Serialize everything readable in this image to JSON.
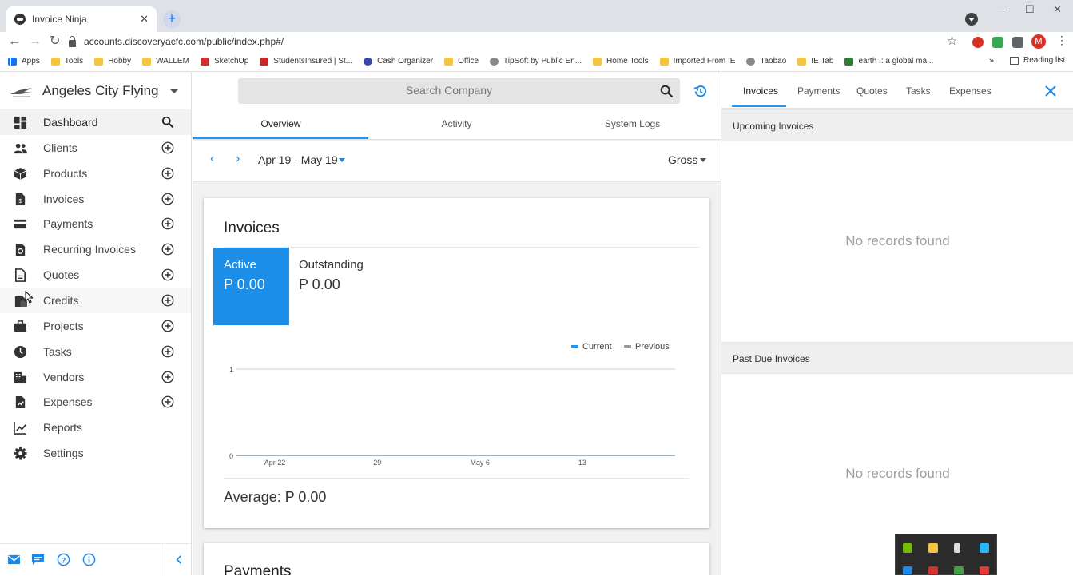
{
  "browser": {
    "tab_title": "Invoice Ninja",
    "new_tab": "+",
    "url": "accounts.discoveryacfc.com/public/index.php#/",
    "profile_initial": "M",
    "bookmarks": [
      "Apps",
      "Tools",
      "Hobby",
      "WALLEM",
      "SketchUp",
      "StudentsInsured | St...",
      "Cash Organizer",
      "Office",
      "TipSoft by Public En...",
      "Home Tools",
      "Imported From IE",
      "Taobao",
      "IE Tab",
      "earth :: a global ma..."
    ],
    "bookmarks_more": "»",
    "reading_list": "Reading list"
  },
  "sidebar": {
    "company": "Angeles City Flying",
    "items": [
      {
        "label": "Dashboard",
        "icon": "dashboard-icon"
      },
      {
        "label": "Clients",
        "icon": "clients-icon"
      },
      {
        "label": "Products",
        "icon": "products-icon"
      },
      {
        "label": "Invoices",
        "icon": "invoices-icon"
      },
      {
        "label": "Payments",
        "icon": "payments-icon"
      },
      {
        "label": "Recurring Invoices",
        "icon": "recurring-icon"
      },
      {
        "label": "Quotes",
        "icon": "quotes-icon"
      },
      {
        "label": "Credits",
        "icon": "credits-icon"
      },
      {
        "label": "Projects",
        "icon": "projects-icon"
      },
      {
        "label": "Tasks",
        "icon": "tasks-icon"
      },
      {
        "label": "Vendors",
        "icon": "vendors-icon"
      },
      {
        "label": "Expenses",
        "icon": "expenses-icon"
      },
      {
        "label": "Reports",
        "icon": "reports-icon"
      },
      {
        "label": "Settings",
        "icon": "settings-icon"
      }
    ]
  },
  "main": {
    "search_placeholder": "Search Company",
    "tabs": [
      "Overview",
      "Activity",
      "System Logs"
    ],
    "date_range": "Apr 19 - May 19",
    "gross_label": "Gross",
    "card_title": "Invoices",
    "active_label": "Active",
    "active_value": "P 0.00",
    "outstanding_label": "Outstanding",
    "outstanding_value": "P 0.00",
    "legend_current": "Current",
    "legend_previous": "Previous",
    "average": "Average: P 0.00",
    "next_card_title": "Payments"
  },
  "chart_data": {
    "type": "line",
    "x": [
      "Apr 22",
      "29",
      "May 6",
      "13"
    ],
    "ylim": [
      0,
      1
    ],
    "yticks": [
      "1",
      "0"
    ],
    "series": [
      {
        "name": "Current",
        "values": [
          0,
          0,
          0,
          0
        ]
      },
      {
        "name": "Previous",
        "values": [
          0,
          0,
          0,
          0
        ]
      }
    ],
    "grid": true,
    "legend": "top-right"
  },
  "right_panel": {
    "tabs": [
      "Invoices",
      "Payments",
      "Quotes",
      "Tasks",
      "Expenses"
    ],
    "upcoming_title": "Upcoming Invoices",
    "upcoming_empty": "No records found",
    "pastdue_title": "Past Due Invoices",
    "pastdue_empty": "No records found"
  },
  "colors": {
    "accent": "#2196f3",
    "active_stat": "#1d8ee8"
  }
}
